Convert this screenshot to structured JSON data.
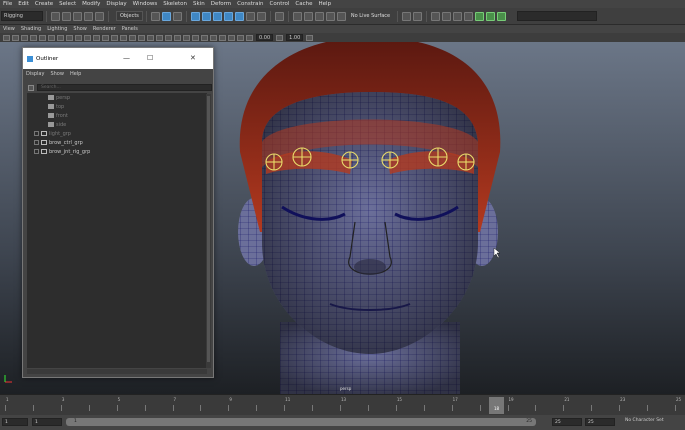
{
  "menubar": {
    "items": [
      "File",
      "Edit",
      "Create",
      "Select",
      "Modify",
      "Display",
      "Windows",
      "Skeleton",
      "Skin",
      "Deform",
      "Constrain",
      "Control",
      "Cache",
      "Help"
    ]
  },
  "statusline": {
    "mode": "Rigging",
    "objects_label": "Objects",
    "live_surface": "No Live Surface"
  },
  "panel_menu": {
    "items": [
      "View",
      "Shading",
      "Lighting",
      "Show",
      "Renderer",
      "Panels"
    ]
  },
  "panel_toolbar": {
    "value1": "0.00",
    "value2": "1.00"
  },
  "viewport": {
    "camera_label": "persp"
  },
  "outliner": {
    "title": "Outliner",
    "min_glyph": "—",
    "max_glyph": "☐",
    "close_glyph": "✕",
    "menu": [
      "Display",
      "Show",
      "Help"
    ],
    "search_placeholder": "Search...",
    "items": [
      {
        "label": "persp",
        "dim": true,
        "group": false
      },
      {
        "label": "top",
        "dim": true,
        "group": false
      },
      {
        "label": "front",
        "dim": true,
        "group": false
      },
      {
        "label": "side",
        "dim": true,
        "group": false
      },
      {
        "label": "light_grp",
        "dim": true,
        "group": true
      },
      {
        "label": "brow_ctrl_grp",
        "dim": false,
        "group": true
      },
      {
        "label": "brow_jnt_rig_grp",
        "dim": false,
        "group": true
      }
    ]
  },
  "timeslider": {
    "ticks": [
      "1",
      "2",
      "3",
      "4",
      "5",
      "6",
      "7",
      "8",
      "9",
      "10",
      "11",
      "12",
      "13",
      "14",
      "15",
      "16",
      "17",
      "18",
      "19",
      "20",
      "21",
      "22",
      "23",
      "24",
      "25"
    ],
    "current_frame": "18"
  },
  "rangeslider": {
    "start": "1",
    "inner_start": "1",
    "bar_start": "1",
    "bar_end": "25",
    "inner_end": "25",
    "end": "25",
    "character_set": "No Character Set"
  },
  "colors": {
    "outliner_selection": "#2e6fa8",
    "control_curve": "#e9dc6a",
    "hair": "#b3391f",
    "mesh_wire": "#0f0f6b"
  }
}
